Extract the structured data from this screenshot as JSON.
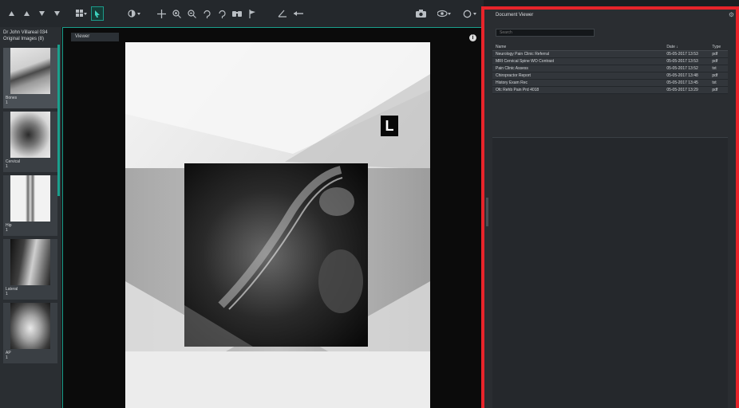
{
  "toolbar": {
    "icons": [
      "up-arrow-icon",
      "up-arrow-icon",
      "down-arrow-icon",
      "down-arrow-icon",
      "layout-grid-icon",
      "select-pointer-icon",
      "contrast-icon",
      "pan-icon",
      "zoom-in-icon",
      "zoom-out-icon",
      "rotate-icon",
      "flip-icon",
      "binoculars-icon",
      "flag-icon",
      "angle-icon",
      "ruler-icon",
      "camera-icon",
      "eye-icon",
      "reset-icon"
    ]
  },
  "patient": {
    "name": "Dr John Villareal 034",
    "images": "Original Images (8)"
  },
  "series": [
    {
      "label": "Bones",
      "count": "1"
    },
    {
      "label": "Cervical",
      "count": "1"
    },
    {
      "label": "Hip",
      "count": "1"
    },
    {
      "label": "Lateral",
      "count": "1"
    },
    {
      "label": "AP",
      "count": "1"
    }
  ],
  "viewer": {
    "tab_label": "Viewer",
    "marker": "L"
  },
  "documents": {
    "title": "Document Viewer",
    "search_placeholder": "Search",
    "columns": {
      "name": "Name",
      "date": "Date ↓",
      "type": "Type"
    },
    "rows": [
      {
        "name": "Neurology Pain Clinic Referral",
        "date": "05-05-2017 13:53",
        "type": "pdf"
      },
      {
        "name": "MRI Cervical Spine WO Contrast",
        "date": "05-05-2017 13:53",
        "type": "pdf"
      },
      {
        "name": "Pain Clinic Assess",
        "date": "05-05-2017 13:52",
        "type": "txt"
      },
      {
        "name": "Chiropractor Report",
        "date": "05-05-2017 13:48",
        "type": "pdf"
      },
      {
        "name": "History Exam Rec",
        "date": "05-05-2017 13:45",
        "type": "txt"
      },
      {
        "name": "Ofc Rehb Pain Prd 4018",
        "date": "05-05-2017 13:29",
        "type": "pdf"
      }
    ]
  },
  "colors": {
    "accent": "#1aa08d",
    "highlight_border": "#e8242a",
    "panel_bg": "#2a2d31"
  }
}
